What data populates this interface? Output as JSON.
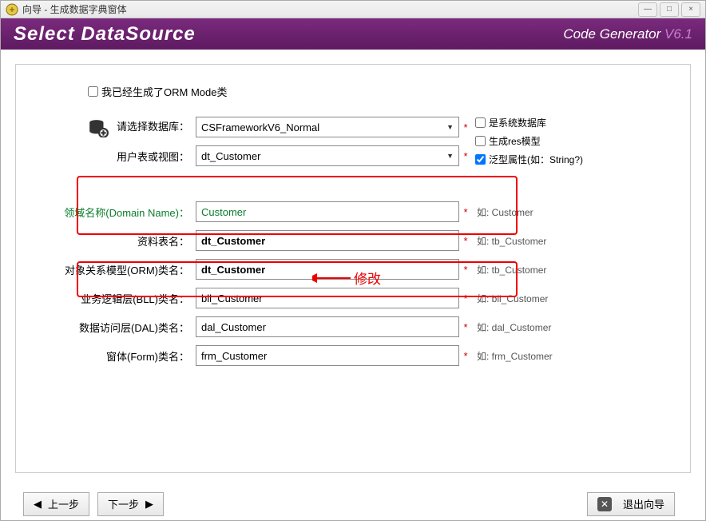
{
  "window": {
    "title": "向导 - 生成数据字典窗体"
  },
  "hero": {
    "title": "Select DataSource",
    "product": "Code Generator",
    "version": "V6.1"
  },
  "checkbox_orm": {
    "label": "我已经生成了ORM Mode类",
    "checked": false
  },
  "database": {
    "label": "请选择数据库：",
    "value": "CSFrameworkV6_Normal"
  },
  "table": {
    "label": "用户表或视图：",
    "value": "dt_Customer"
  },
  "side_checks": {
    "sysdb": {
      "label": "是系统数据库",
      "checked": false
    },
    "resmodel": {
      "label": "生成res模型",
      "checked": false
    },
    "generic": {
      "label": "泛型属性(如：String?)",
      "checked": true
    }
  },
  "domain": {
    "label": "领域名称(Domain Name)：",
    "value": "Customer",
    "hint": "如: Customer",
    "annotation": "修改"
  },
  "rows": [
    {
      "label": "资料表名：",
      "value": "dt_Customer",
      "hint": "如: tb_Customer"
    },
    {
      "label": "对象关系模型(ORM)类名：",
      "value": "dt_Customer",
      "hint": "如: tb_Customer"
    },
    {
      "label": "业务逻辑层(BLL)类名：",
      "value": "bll_Customer",
      "hint": "如: bll_Customer"
    },
    {
      "label": "数据访问层(DAL)类名：",
      "value": "dal_Customer",
      "hint": "如: dal_Customer"
    },
    {
      "label": "窗体(Form)类名：",
      "value": "frm_Customer",
      "hint": "如: frm_Customer"
    }
  ],
  "footer": {
    "prev": "上一步",
    "next": "下一步",
    "exit": "退出向导"
  },
  "star": "*"
}
